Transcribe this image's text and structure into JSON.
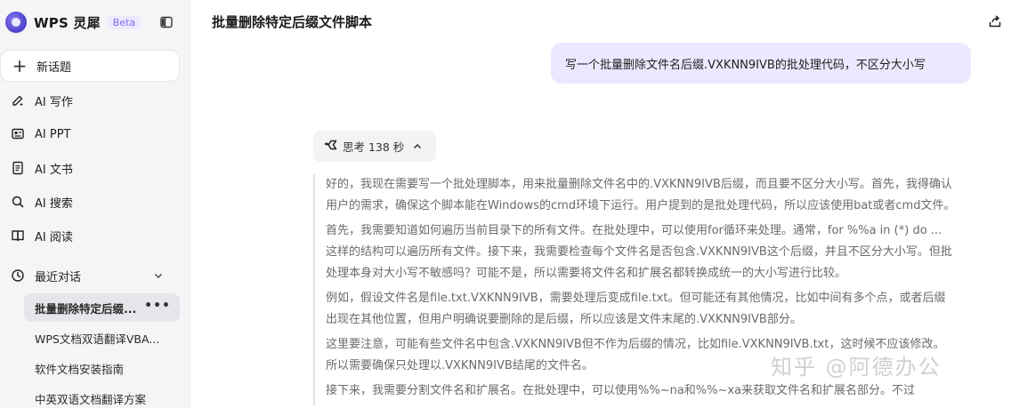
{
  "brand": {
    "name": "WPS 灵犀",
    "badge": "Beta"
  },
  "sidebar": {
    "new_chat": "新话题",
    "nav": [
      {
        "label": "AI 写作",
        "icon": "pen-sparkle-icon"
      },
      {
        "label": "AI PPT",
        "icon": "presentation-icon"
      },
      {
        "label": "AI 文书",
        "icon": "document-icon"
      },
      {
        "label": "AI 搜索",
        "icon": "search-icon"
      },
      {
        "label": "AI 阅读",
        "icon": "book-icon"
      }
    ],
    "recent_label": "最近对话",
    "history": [
      {
        "label": "批量删除特定后缀...",
        "active": true
      },
      {
        "label": "WPS文档双语翻译VBA..."
      },
      {
        "label": "软件文档安装指南"
      },
      {
        "label": "中英双语文档翻译方案"
      }
    ]
  },
  "main": {
    "title": "批量删除特定后缀文件脚本",
    "user_message": "写一个批量删除文件名后缀.VXKNN9IVB的批处理代码，不区分大小写",
    "thinking_label": "思考 138 秒",
    "thinking_paragraphs": [
      "好的，我现在需要写一个批处理脚本，用来批量删除文件名中的.VXKNN9IVB后缀，而且要不区分大小写。首先，我得确认用户的需求，确保这个脚本能在Windows的cmd环境下运行。用户提到的是批处理代码，所以应该使用bat或者cmd文件。",
      "首先，我需要知道如何遍历当前目录下的所有文件。在批处理中，可以使用for循环来处理。通常，for %%a in (*) do ... 这样的结构可以遍历所有文件。接下来，我需要检查每个文件名是否包含.VXKNN9IVB这个后缀，并且不区分大小写。但批处理本身对大小写不敏感吗？可能不是，所以需要将文件名和扩展名都转换成统一的大小写进行比较。",
      "例如，假设文件名是file.txt.VXKNN9IVB，需要处理后变成file.txt。但可能还有其他情况，比如中间有多个点，或者后缀出现在其他位置，但用户明确说要删除的是后缀，所以应该是文件末尾的.VXKNN9IVB部分。",
      "这里要注意，可能有些文件名中包含.VXKNN9IVB但不作为后缀的情况，比如file.VXKNN9IVB.txt，这时候不应该修改。所以需要确保只处理以.VXKNN9IVB结尾的文件名。",
      "接下来，我需要分割文件名和扩展名。在批处理中，可以使用%%~na和%%~xa来获取文件名和扩展名部分。不过"
    ]
  },
  "watermark": "知乎 @阿德办公"
}
